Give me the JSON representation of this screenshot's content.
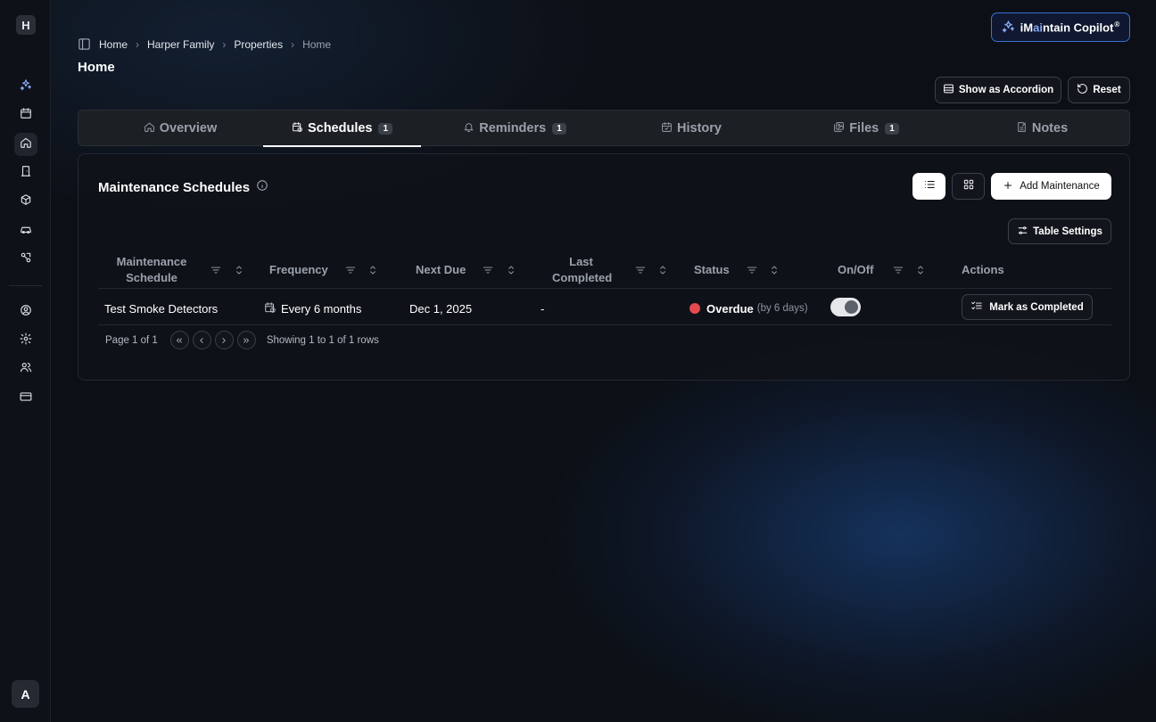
{
  "sidebar": {
    "logo_letter": "H",
    "avatar_letter": "A",
    "items": [
      {
        "icon": "sparkles-icon"
      },
      {
        "icon": "calendar-icon"
      },
      {
        "icon": "home-icon",
        "active": true
      },
      {
        "icon": "door-icon"
      },
      {
        "icon": "box-icon"
      },
      {
        "icon": "car-icon"
      },
      {
        "icon": "tools-icon"
      },
      {
        "icon": "user-circle-icon"
      },
      {
        "icon": "gear-icon"
      },
      {
        "icon": "users-icon"
      },
      {
        "icon": "credit-card-icon"
      }
    ]
  },
  "breadcrumb": [
    "Home",
    "Harper Family",
    "Properties",
    "Home"
  ],
  "page_title": "Home",
  "copilot": {
    "pre": "iM",
    "ai": "ai",
    "post": "ntain Copilot",
    "reg": "®"
  },
  "actions": {
    "accordion": "Show as Accordion",
    "reset": "Reset"
  },
  "tabs": [
    {
      "label": "Overview",
      "badge": ""
    },
    {
      "label": "Schedules",
      "badge": "1",
      "active": true
    },
    {
      "label": "Reminders",
      "badge": "1"
    },
    {
      "label": "History",
      "badge": ""
    },
    {
      "label": "Files",
      "badge": "1"
    },
    {
      "label": "Notes",
      "badge": ""
    }
  ],
  "panel": {
    "title": "Maintenance Schedules",
    "add_label": "Add Maintenance",
    "table_settings": "Table Settings"
  },
  "table": {
    "headers": {
      "schedule_1": "Maintenance",
      "schedule_2": "Schedule",
      "frequency": "Frequency",
      "next_due": "Next Due",
      "last_1": "Last",
      "last_2": "Completed",
      "status": "Status",
      "onoff": "On/Off",
      "actions": "Actions"
    },
    "rows": [
      {
        "schedule": "Test Smoke Detectors",
        "frequency": "Every 6 months",
        "next_due": "Dec 1, 2025",
        "last_completed": "-",
        "status": "Overdue",
        "status_detail": "(by 6 days)",
        "enabled": true,
        "action": "Mark as Completed"
      }
    ]
  },
  "pager": {
    "page_text": "Page 1 of 1",
    "showing_text": "Showing 1 to 1 of 1 rows"
  },
  "colors": {
    "accent": "#3b6fd6",
    "overdue": "#e5484d"
  }
}
